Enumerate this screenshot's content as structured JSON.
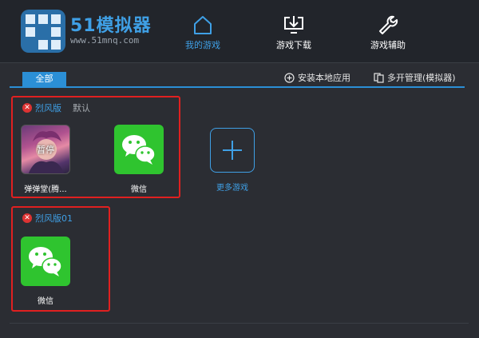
{
  "brand": {
    "title": "51模拟器",
    "subtitle": "www.51mnq.com"
  },
  "nav": {
    "my_games": "我的游戏",
    "download": "游戏下载",
    "assist": "游戏辅助"
  },
  "toolbar": {
    "tab_all": "全部",
    "install_local": "安装本地应用",
    "multi_manage": "多开管理(模拟器)"
  },
  "groups": [
    {
      "name": "烈风版",
      "tag": "默认",
      "apps": [
        {
          "label": "弹弹堂(腾...",
          "overlay": "暂停",
          "icon": "game-portrait-icon"
        },
        {
          "label": "微信",
          "icon": "wechat-icon"
        }
      ],
      "add_more": "更多游戏"
    },
    {
      "name": "烈风版01",
      "apps": [
        {
          "label": "微信",
          "icon": "wechat-icon"
        }
      ]
    }
  ],
  "colors": {
    "accent": "#3fa0e6",
    "highlight_box": "#e02020",
    "wechat_green": "#2fc42f",
    "background": "#2b2d33"
  }
}
